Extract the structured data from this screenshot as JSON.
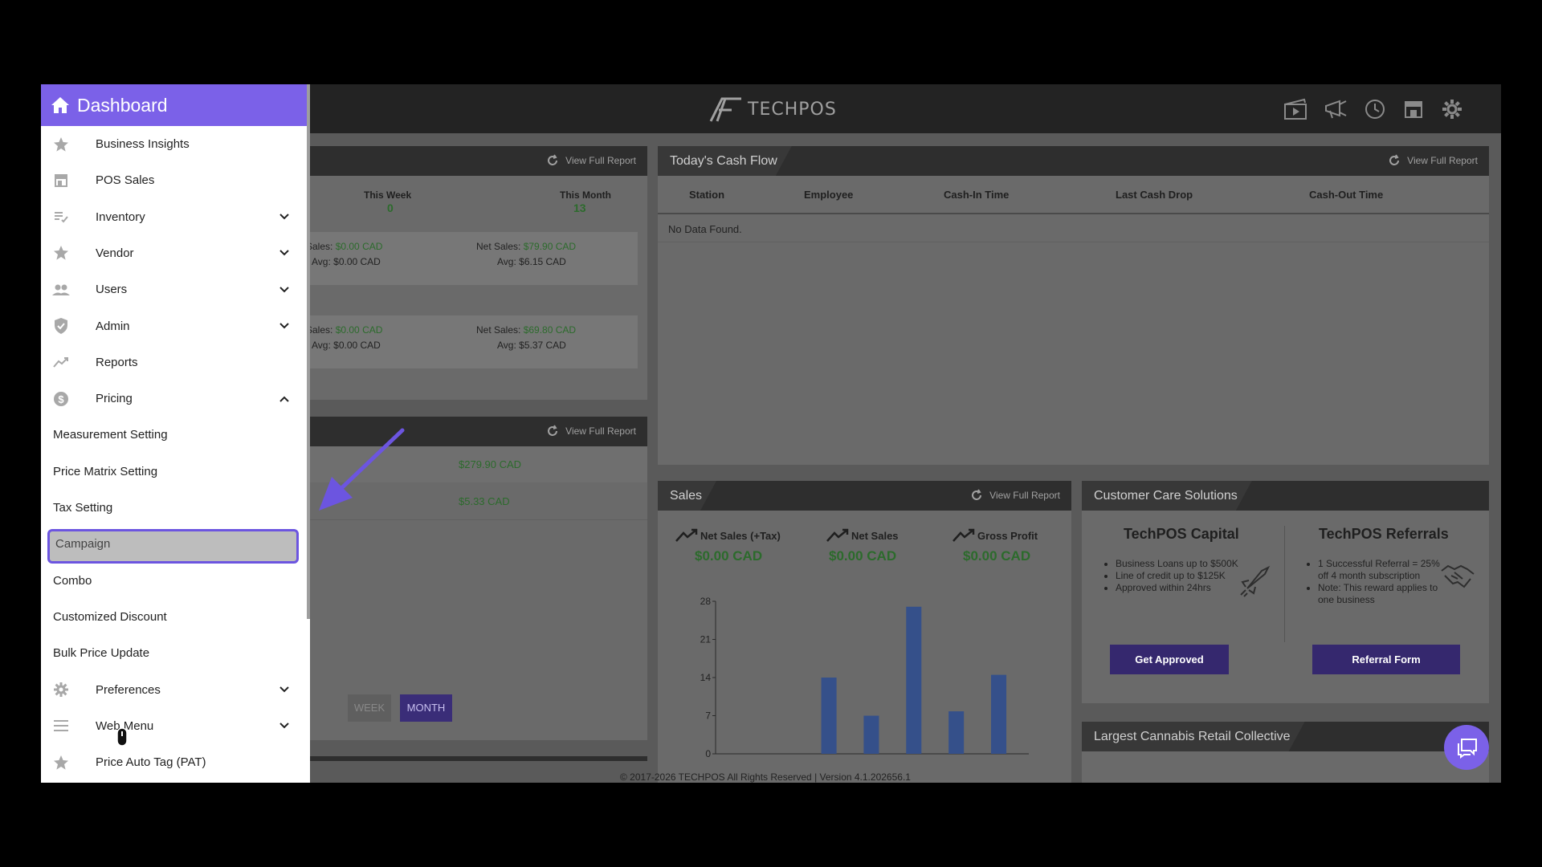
{
  "topbar": {
    "logo_text": "TECHPOS"
  },
  "sidebar": {
    "header": "Dashboard",
    "items": [
      {
        "label": "Business Insights",
        "icon": "star-icon",
        "chevron": ""
      },
      {
        "label": "POS Sales",
        "icon": "store-icon",
        "chevron": ""
      },
      {
        "label": "Inventory",
        "icon": "checklist-icon",
        "chevron": "down"
      },
      {
        "label": "Vendor",
        "icon": "star-icon",
        "chevron": "down"
      },
      {
        "label": "Users",
        "icon": "people-icon",
        "chevron": "down"
      },
      {
        "label": "Admin",
        "icon": "shield-icon",
        "chevron": "down"
      },
      {
        "label": "Reports",
        "icon": "trending-icon",
        "chevron": ""
      },
      {
        "label": "Pricing",
        "icon": "dollar-icon",
        "chevron": "up"
      },
      {
        "label": "Measurement Setting",
        "icon": "",
        "chevron": ""
      },
      {
        "label": "Price Matrix Setting",
        "icon": "",
        "chevron": ""
      },
      {
        "label": "Tax Setting",
        "icon": "",
        "chevron": ""
      },
      {
        "label": "Campaign",
        "icon": "",
        "chevron": ""
      },
      {
        "label": "Combo",
        "icon": "",
        "chevron": ""
      },
      {
        "label": "Customized Discount",
        "icon": "",
        "chevron": ""
      },
      {
        "label": "Bulk Price Update",
        "icon": "",
        "chevron": ""
      },
      {
        "label": "Preferences",
        "icon": "gear-icon",
        "chevron": "down"
      },
      {
        "label": "Web Menu",
        "icon": "menu-icon",
        "chevron": "down"
      },
      {
        "label": "Price Auto Tag (PAT)",
        "icon": "star-icon",
        "chevron": ""
      }
    ]
  },
  "panel1": {
    "view_full_report": "View Full Report",
    "this_week": "This Week",
    "this_week_val": "0",
    "this_month": "This Month",
    "this_month_val": "13",
    "row1": {
      "sales_lbl": "Sales:",
      "sales_val": "$0.00 CAD",
      "avg_lbl": "Avg:",
      "avg_val": "$0.00 CAD",
      "net_lbl": "Net Sales:",
      "net_val": "$79.90 CAD",
      "avg2_lbl": "Avg:",
      "avg2_val": "$6.15 CAD"
    },
    "row2": {
      "sales_lbl": "Sales:",
      "sales_val": "$0.00 CAD",
      "avg_lbl": "Avg:",
      "avg_val": "$0.00 CAD",
      "net_lbl": "Net Sales:",
      "net_val": "$69.80 CAD",
      "avg2_lbl": "Avg:",
      "avg2_val": "$5.37 CAD"
    }
  },
  "panel2": {
    "view_full_report": "View Full Report",
    "val1": "$279.90 CAD",
    "val2": "$5.33 CAD",
    "week_btn": "WEEK",
    "month_btn": "MONTH"
  },
  "cashflow": {
    "title": "Today's Cash Flow",
    "view_full_report": "View Full Report",
    "columns": [
      "Station",
      "Employee",
      "Cash-In Time",
      "Last Cash Drop",
      "Cash-Out Time"
    ],
    "empty": "No Data Found."
  },
  "sales": {
    "title": "Sales",
    "view_full_report": "View Full Report",
    "metrics": [
      {
        "label": "Net Sales (+Tax)",
        "value": "$0.00 CAD"
      },
      {
        "label": "Net Sales",
        "value": "$0.00 CAD"
      },
      {
        "label": "Gross Profit",
        "value": "$0.00 CAD"
      }
    ]
  },
  "chart_data": {
    "type": "bar",
    "title": "",
    "ylim": [
      0,
      28
    ],
    "yticks": [
      "0",
      "7",
      "14",
      "21",
      "28"
    ],
    "values": [
      0,
      0,
      14,
      7,
      27,
      7.8,
      14.5
    ]
  },
  "care": {
    "title": "Customer Care Solutions",
    "capital_title": "TechPOS Capital",
    "capital_points": [
      "Business Loans up to $500K",
      "Line of credit up to $125K",
      "Approved within 24hrs"
    ],
    "capital_btn": "Get Approved",
    "referral_title": "TechPOS Referrals",
    "referral_points": [
      "1 Successful Referral = 25% off 4 month subscription",
      "Note: This reward applies to one business"
    ],
    "referral_btn": "Referral Form"
  },
  "cannabis": {
    "title": "Largest Cannabis Retail Collective"
  },
  "footer": {
    "text": "© 2017-2026 TECHPOS All Rights Reserved | Version 4.1.202656.1"
  }
}
